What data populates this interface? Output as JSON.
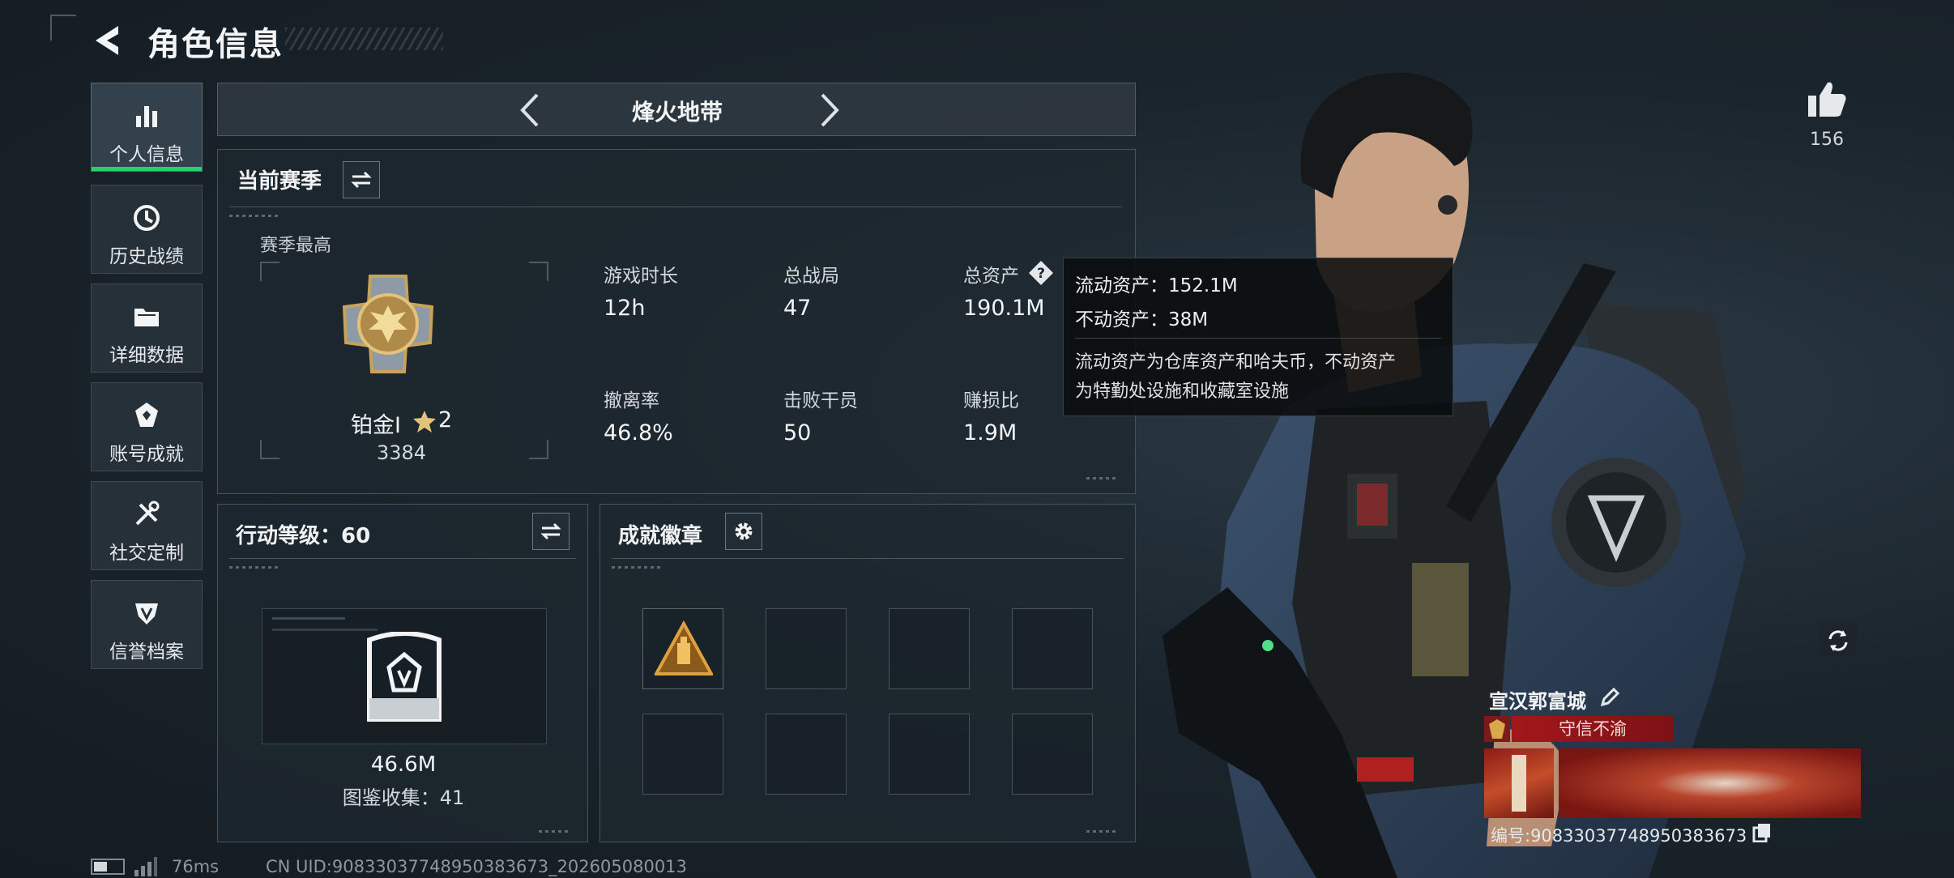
{
  "header": {
    "title": "角色信息"
  },
  "sidebar": {
    "items": [
      {
        "label": "个人信息",
        "icon": "bar-chart-icon",
        "active": true
      },
      {
        "label": "历史战绩",
        "icon": "history-icon"
      },
      {
        "label": "详细数据",
        "icon": "folder-icon"
      },
      {
        "label": "账号成就",
        "icon": "achievement-icon"
      },
      {
        "label": "社交定制",
        "icon": "tools-icon"
      },
      {
        "label": "信誉档案",
        "icon": "credit-icon"
      }
    ]
  },
  "mode_selector": {
    "label": "烽火地带"
  },
  "season": {
    "title": "当前赛季",
    "best_label": "赛季最高",
    "rank_name": "铂金I",
    "rank_stars": "2",
    "rank_score": "3384",
    "stats": [
      {
        "label": "游戏时长",
        "value": "12h"
      },
      {
        "label": "总战局",
        "value": "47"
      },
      {
        "label": "总资产",
        "value": "190.1M"
      },
      {
        "label": "撤离率",
        "value": "46.8%"
      },
      {
        "label": "击败干员",
        "value": "50"
      },
      {
        "label": "赚损比",
        "value": "1.9M"
      }
    ]
  },
  "tooltip": {
    "line1": "流动资产：152.1M",
    "line2": "不动资产：38M",
    "desc1": "流动资产为仓库资产和哈夫币，不动资产",
    "desc2": "为特勤处设施和收藏室设施"
  },
  "action_level": {
    "title": "行动等级：60",
    "value": "46.6M",
    "collection": "图鉴收集：41"
  },
  "badges": {
    "title": "成就徽章"
  },
  "likes": {
    "count": "156"
  },
  "profile": {
    "name": "宣汉郭富城",
    "title_tag": "守信不渝",
    "id_text": "编号:9083303774895038367​3"
  },
  "status_bar": {
    "ping": "76ms",
    "uid": "CN UID:9083303774895038367​3_202605080013"
  },
  "colors": {
    "accent_green": "#27d06a",
    "tag_red": "#a3171b",
    "gold": "#c9a25a"
  }
}
